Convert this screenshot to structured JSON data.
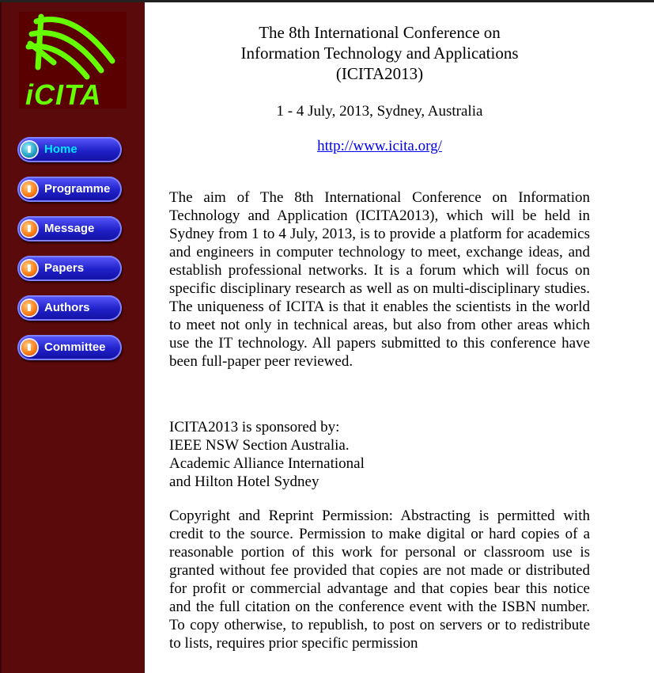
{
  "logo": {
    "text": "iCITA"
  },
  "nav": [
    {
      "label": "Home",
      "active": true
    },
    {
      "label": "Programme",
      "active": false
    },
    {
      "label": "Message",
      "active": false
    },
    {
      "label": "Papers",
      "active": false
    },
    {
      "label": "Authors",
      "active": false
    },
    {
      "label": "Committee",
      "active": false
    }
  ],
  "header": {
    "title_line1": "The 8th International Conference on",
    "title_line2": "Information Technology and Applications",
    "title_line3": "(ICITA2013)",
    "dates": "1 - 4 July, 2013, Sydney, Australia",
    "url": "http://www.icita.org/"
  },
  "content": {
    "aim": "The aim of The 8th International Conference on Information Technology and Application (ICITA2013), which will be held in Sydney from 1 to 4 July, 2013, is to provide a platform for academics and engineers in computer technology to meet, exchange ideas, and establish professional networks. It is a forum which will focus on specific disciplinary research as well as on multi-disciplinary studies. The uniqueness of ICITA is that it enables the scientists in the world to meet not only in technical areas, but also from other areas which use the IT technology. All papers submitted to this conference have been full-paper peer reviewed.",
    "sponsor_heading": "ICITA2013 is sponsored by:",
    "sponsors": [
      "IEEE NSW Section Australia.",
      "Academic Alliance International",
      "and Hilton Hotel Sydney"
    ],
    "copyright": "Copyright and Reprint Permission: Abstracting is permitted with credit to the source. Permission to make digital or hard copies of a reasonable portion of this work for personal or classroom use is granted without fee provided that copies are not made or distributed for profit or commercial advantage and that copies bear this notice and the full citation on the conference event with the ISBN number. To copy otherwise, to republish, to post on servers or to redistribute to lists, requires prior specific permission"
  },
  "colors": {
    "sidebar": "#5a0a0a",
    "logo_green": "#66ff00",
    "button_blue": "#2020c8",
    "link": "#0000ee"
  }
}
